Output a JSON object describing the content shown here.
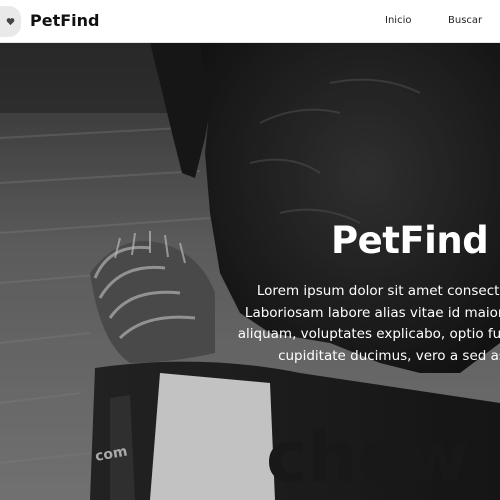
{
  "brand": {
    "name": "PetFind",
    "logo_icon": "heart-icon"
  },
  "nav": {
    "links": [
      {
        "label": "Inicio"
      },
      {
        "label": "Buscar"
      }
    ]
  },
  "hero": {
    "title": "PetFind",
    "lines": [
      "Lorem ipsum dolor sit amet consectetur",
      "Laboriosam labore alias vitae id maiores, la",
      "aliquam, voluptates explicabo, optio fuga sap",
      "cupiditate ducimus, vero a sed as"
    ],
    "image_subject": "dog chewing toy (grayscale photo)",
    "toy_text": "chew",
    "toy_small_text": "com"
  },
  "colors": {
    "navbar_bg": "#ffffff",
    "text_dark": "#111111",
    "hero_text": "#ffffff"
  }
}
